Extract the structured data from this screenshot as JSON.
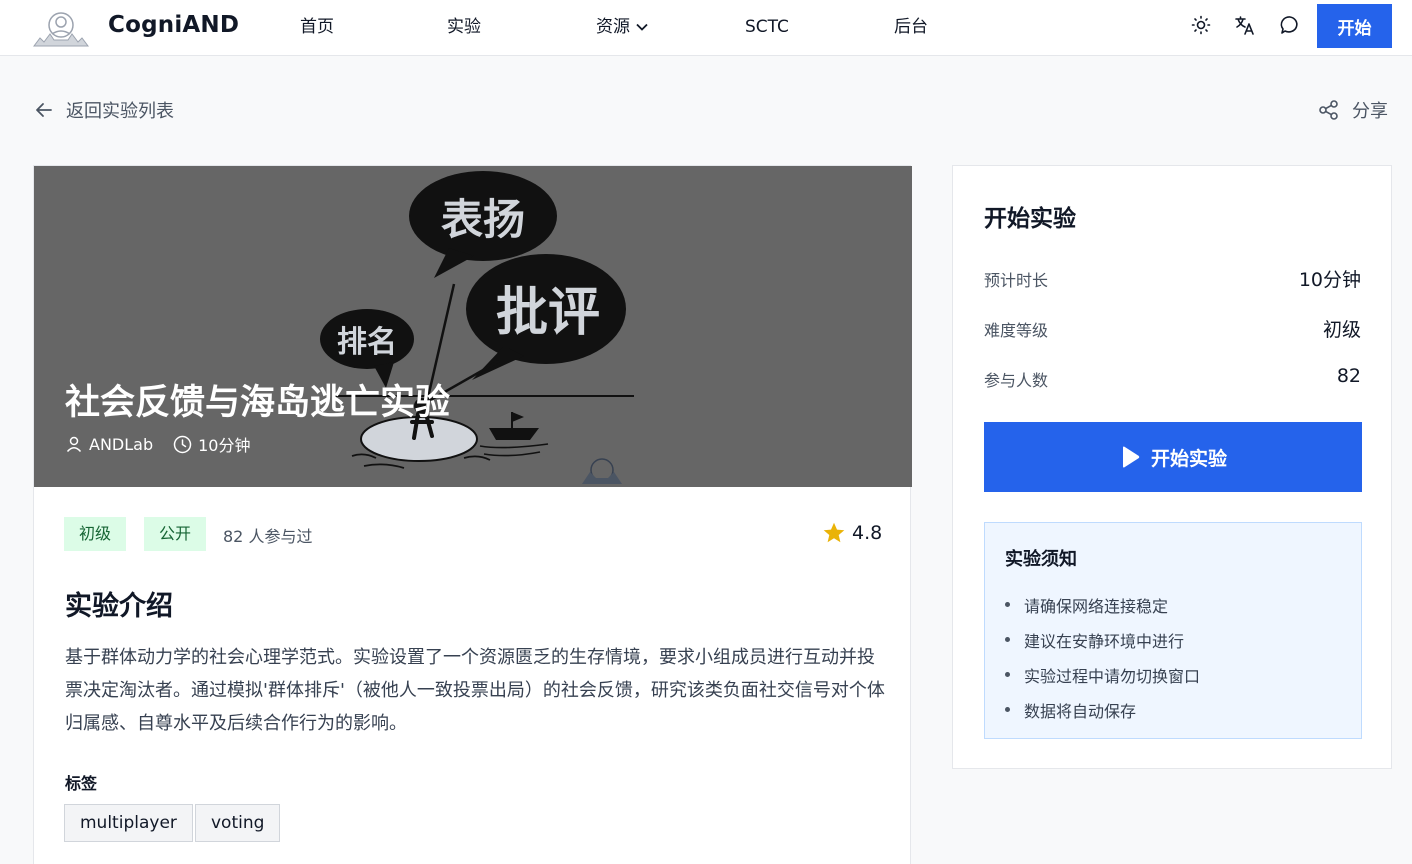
{
  "nav": {
    "brand": "CogniAND",
    "items": [
      "首页",
      "实验",
      "资源",
      "SCTC",
      "后台"
    ],
    "start_label": "开始",
    "icons": [
      "logo-icon",
      "sun-icon",
      "translate-icon",
      "chat-icon"
    ]
  },
  "back_label": "返回实验列表",
  "share_label": "分享",
  "hero": {
    "image_words": [
      "表扬",
      "批评",
      "排名"
    ],
    "title": "社会反馈与海岛逃亡实验",
    "author": "ANDLab",
    "duration": "10分钟"
  },
  "badges": [
    "初级",
    "公开"
  ],
  "participants_text": "82 人参与过",
  "rating": "4.8",
  "intro": {
    "heading": "实验介绍",
    "body": "基于群体动力学的社会心理学范式。实验设置了一个资源匮乏的生存情境，要求小组成员进行互动并投票决定淘汰者。通过模拟'群体排斥'（被他人一致投票出局）的社会反馈，研究该类负面社交信号对个体归属感、自尊水平及后续合作行为的影响。"
  },
  "tags": {
    "heading": "标签",
    "items": [
      "multiplayer",
      "voting"
    ]
  },
  "side": {
    "heading": "开始实验",
    "rows": [
      {
        "label": "预计时长",
        "value": "10分钟"
      },
      {
        "label": "难度等级",
        "value": "初级"
      },
      {
        "label": "参与人数",
        "value": "82"
      }
    ],
    "button_label": "开始实验",
    "notice": {
      "heading": "实验须知",
      "items": [
        "请确保网络连接稳定",
        "建议在安静环境中进行",
        "实验过程中请勿切换窗口",
        "数据将自动保存"
      ]
    }
  },
  "colors": {
    "accent": "#2563eb",
    "badge_bg": "#dcfce7",
    "badge_text": "#166534",
    "hero_bg": "#666666",
    "star": "#eab308"
  }
}
